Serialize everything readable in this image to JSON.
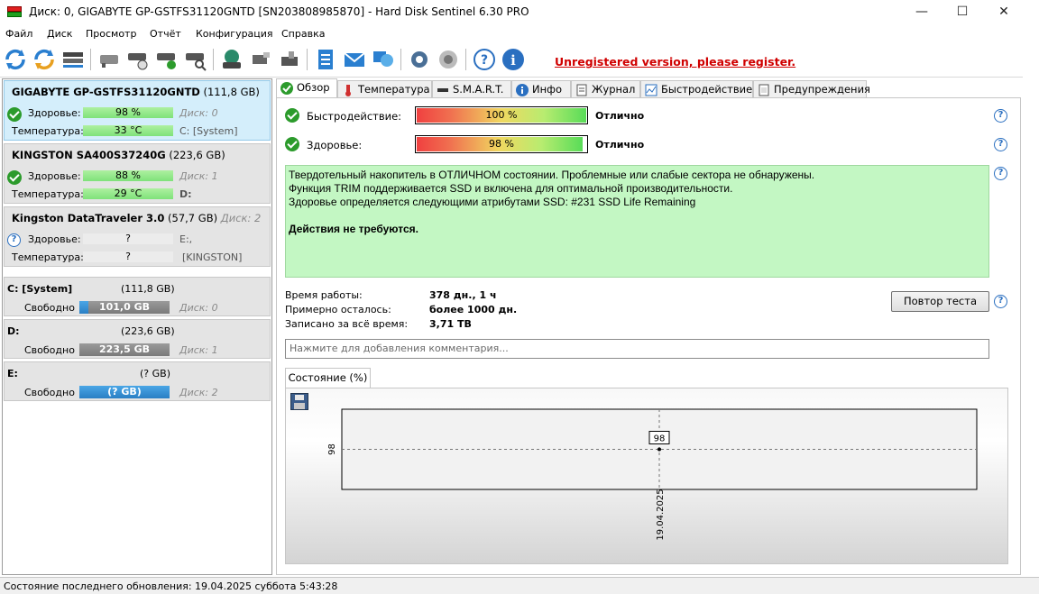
{
  "window": {
    "title": "Диск: 0, GIGABYTE GP-GSTFS31120GNTD [SN203808985870]  -  Hard Disk Sentinel 6.30 PRO",
    "minimize": "—",
    "maximize": "☐",
    "close": "✕"
  },
  "menu": [
    "Файл",
    "Диск",
    "Просмотр",
    "Отчёт",
    "Конфигурация",
    "Справка"
  ],
  "toolbar": {
    "unregistered": "Unregistered version, please register."
  },
  "disks": [
    {
      "name": "GIGABYTE GP-GSTFS31120GNTD",
      "size": "(111,8 GB)",
      "health_label": "Здоровье:",
      "health": "98 %",
      "disk_index": "Диск: 0",
      "temp_label": "Температура:",
      "temp": "33 °C",
      "drive": "C: [System]"
    },
    {
      "name": "KINGSTON SA400S37240G",
      "size": "(223,6 GB)",
      "health_label": "Здоровье:",
      "health": "88 %",
      "disk_index": "Диск: 1",
      "temp_label": "Температура:",
      "temp": "29 °C",
      "drive": "D:"
    },
    {
      "name": "Kingston DataTraveler 3.0",
      "size": "(57,7 GB)",
      "health_label": "Здоровье:",
      "health": "?",
      "disk_index": "Диск: 2",
      "temp_label": "Температура:",
      "temp": "?",
      "drive": "E:,",
      "drive2": "[KINGSTON]"
    }
  ],
  "partitions": [
    {
      "name": "C: [System]",
      "size": "(111,8 GB)",
      "free_label": "Свободно",
      "free": "101,0 GB",
      "disk": "Диск: 0"
    },
    {
      "name": "D:",
      "size": "(223,6 GB)",
      "free_label": "Свободно",
      "free": "223,5 GB",
      "disk": "Диск: 1"
    },
    {
      "name": "E:",
      "size": "(? GB)",
      "free_label": "Свободно",
      "free": "(? GB)",
      "disk": "Диск: 2"
    }
  ],
  "tabs": [
    "Обзор",
    "Температура",
    "S.M.A.R.T.",
    "Инфо",
    "Журнал",
    "Быстродействие",
    "Предупреждения"
  ],
  "overview": {
    "performance_label": "Быстродействие:",
    "performance_value": "100 %",
    "performance_level": 100,
    "performance_rating": "Отлично",
    "health_label": "Здоровье:",
    "health_value": "98 %",
    "health_level": 98,
    "health_rating": "Отлично",
    "info_line1": "Твердотельный накопитель в ОТЛИЧНОМ состоянии. Проблемные или слабые сектора не обнаружены.",
    "info_line2": "Функция TRIM поддерживается SSD и включена для оптимальной производительности.",
    "info_line3": "Здоровье определяется следующими атрибутами SSD: #231 SSD Life Remaining",
    "info_action": "Действия не требуются.",
    "uptime_label": "Время работы:",
    "uptime_value": "378 дн., 1 ч",
    "remaining_label": "Примерно осталось:",
    "remaining_value": "более 1000 дн.",
    "written_label": "Записано за всё время:",
    "written_value": "3,71 TB",
    "retest_button": "Повтор теста",
    "comment_placeholder": "Нажмите для добавления комментария...",
    "subtab": "Состояние (%)"
  },
  "chart_data": {
    "type": "line",
    "x": [
      "19.04.2025"
    ],
    "series": [
      {
        "values": [
          98
        ]
      }
    ],
    "ylabel_tick": "98",
    "point_label": "98",
    "grid": true
  },
  "status": {
    "text": "Состояние последнего обновления: 19.04.2025 суббота 5:43:28"
  }
}
